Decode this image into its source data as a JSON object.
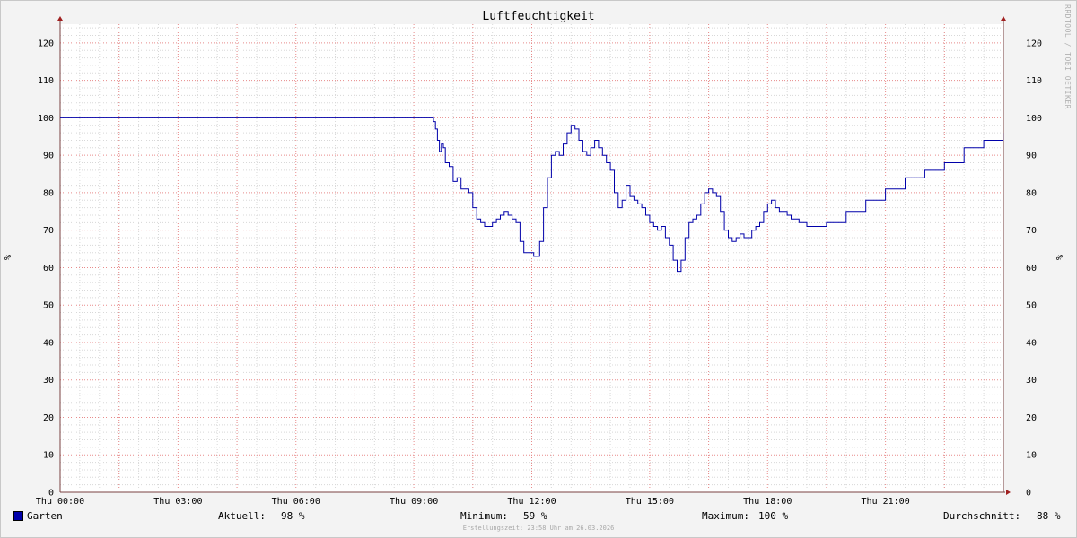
{
  "chart_data": {
    "type": "line",
    "title": "Luftfeuchtigkeit",
    "ylabel_left": "%",
    "ylabel_right": "%",
    "ylim": [
      0,
      125
    ],
    "y_ticks": [
      0,
      10,
      20,
      30,
      40,
      50,
      60,
      70,
      80,
      90,
      100,
      110,
      120
    ],
    "x_ticks": [
      "Thu 00:00",
      "Thu 03:00",
      "Thu 06:00",
      "Thu 09:00",
      "Thu 12:00",
      "Thu 15:00",
      "Thu 18:00",
      "Thu 21:00"
    ],
    "grid": true,
    "series": [
      {
        "name": "Garten",
        "color": "#0000aa",
        "x_hours": [
          0,
          9.4,
          9.5,
          9.55,
          9.6,
          9.65,
          9.7,
          9.75,
          9.8,
          9.9,
          10.0,
          10.05,
          10.1,
          10.2,
          10.3,
          10.4,
          10.5,
          10.6,
          10.7,
          10.8,
          10.9,
          11.0,
          11.1,
          11.2,
          11.3,
          11.4,
          11.5,
          11.6,
          11.7,
          11.8,
          11.9,
          12.0,
          12.05,
          12.1,
          12.2,
          12.3,
          12.4,
          12.5,
          12.6,
          12.7,
          12.8,
          12.9,
          13.0,
          13.1,
          13.2,
          13.3,
          13.4,
          13.5,
          13.6,
          13.7,
          13.8,
          13.9,
          14.0,
          14.1,
          14.2,
          14.3,
          14.4,
          14.5,
          14.6,
          14.7,
          14.8,
          14.9,
          15.0,
          15.1,
          15.2,
          15.3,
          15.4,
          15.5,
          15.6,
          15.7,
          15.8,
          15.9,
          16.0,
          16.1,
          16.2,
          16.3,
          16.4,
          16.5,
          16.6,
          16.7,
          16.8,
          16.9,
          17.0,
          17.1,
          17.2,
          17.3,
          17.4,
          17.5,
          17.6,
          17.7,
          17.8,
          17.9,
          18.0,
          18.1,
          18.2,
          18.3,
          18.4,
          18.5,
          18.6,
          18.7,
          18.8,
          18.9,
          19.0,
          19.5,
          20.0,
          20.5,
          21.0,
          21.5,
          22.0,
          22.5,
          23.0,
          23.5,
          23.99
        ],
        "values": [
          100,
          100,
          99,
          97,
          94,
          91,
          93,
          92,
          88,
          87,
          83,
          83,
          84,
          81,
          81,
          80,
          76,
          73,
          72,
          71,
          71,
          72,
          73,
          74,
          75,
          74,
          73,
          72,
          67,
          64,
          64,
          64,
          63,
          63,
          67,
          76,
          84,
          90,
          91,
          90,
          93,
          96,
          98,
          97,
          94,
          91,
          90,
          92,
          94,
          92,
          90,
          88,
          86,
          80,
          76,
          78,
          82,
          79,
          78,
          77,
          76,
          74,
          72,
          71,
          70,
          71,
          68,
          66,
          62,
          59,
          62,
          68,
          72,
          73,
          74,
          77,
          80,
          81,
          80,
          79,
          75,
          70,
          68,
          67,
          68,
          69,
          68,
          68,
          70,
          71,
          72,
          75,
          77,
          78,
          76,
          75,
          75,
          74,
          73,
          73,
          72,
          72,
          71,
          72,
          75,
          78,
          81,
          84,
          86,
          88,
          92,
          94,
          96,
          97,
          98
        ]
      }
    ]
  },
  "watermark": "RRDTOOL / TOBI OETIKER",
  "legend": {
    "series_name": "Garten",
    "current_label": "Aktuell:",
    "current_value": "98 %",
    "min_label": "Minimum:",
    "min_value": "59 %",
    "max_label": "Maximum:",
    "max_value": "100 %",
    "avg_label": "Durchschnitt:",
    "avg_value": "88 %"
  },
  "footer": "Erstellungszeit: 23:58 Uhr am 26.03.2026",
  "colors": {
    "background": "#f3f3f3",
    "plot_background": "#ffffff",
    "major_grid": "#e88a8a",
    "minor_grid": "#d8d8d8",
    "axis": "#7a4040",
    "line": "#0000aa"
  }
}
